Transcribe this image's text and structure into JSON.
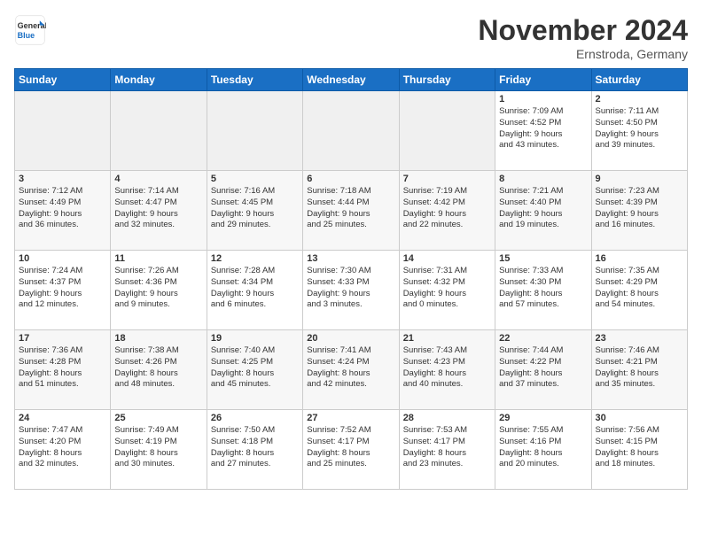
{
  "header": {
    "logo_general": "General",
    "logo_blue": "Blue",
    "month_title": "November 2024",
    "location": "Ernstroda, Germany"
  },
  "weekdays": [
    "Sunday",
    "Monday",
    "Tuesday",
    "Wednesday",
    "Thursday",
    "Friday",
    "Saturday"
  ],
  "weeks": [
    [
      {
        "day": "",
        "info": "",
        "empty": true
      },
      {
        "day": "",
        "info": "",
        "empty": true
      },
      {
        "day": "",
        "info": "",
        "empty": true
      },
      {
        "day": "",
        "info": "",
        "empty": true
      },
      {
        "day": "",
        "info": "",
        "empty": true
      },
      {
        "day": "1",
        "info": "Sunrise: 7:09 AM\nSunset: 4:52 PM\nDaylight: 9 hours\nand 43 minutes."
      },
      {
        "day": "2",
        "info": "Sunrise: 7:11 AM\nSunset: 4:50 PM\nDaylight: 9 hours\nand 39 minutes."
      }
    ],
    [
      {
        "day": "3",
        "info": "Sunrise: 7:12 AM\nSunset: 4:49 PM\nDaylight: 9 hours\nand 36 minutes."
      },
      {
        "day": "4",
        "info": "Sunrise: 7:14 AM\nSunset: 4:47 PM\nDaylight: 9 hours\nand 32 minutes."
      },
      {
        "day": "5",
        "info": "Sunrise: 7:16 AM\nSunset: 4:45 PM\nDaylight: 9 hours\nand 29 minutes."
      },
      {
        "day": "6",
        "info": "Sunrise: 7:18 AM\nSunset: 4:44 PM\nDaylight: 9 hours\nand 25 minutes."
      },
      {
        "day": "7",
        "info": "Sunrise: 7:19 AM\nSunset: 4:42 PM\nDaylight: 9 hours\nand 22 minutes."
      },
      {
        "day": "8",
        "info": "Sunrise: 7:21 AM\nSunset: 4:40 PM\nDaylight: 9 hours\nand 19 minutes."
      },
      {
        "day": "9",
        "info": "Sunrise: 7:23 AM\nSunset: 4:39 PM\nDaylight: 9 hours\nand 16 minutes."
      }
    ],
    [
      {
        "day": "10",
        "info": "Sunrise: 7:24 AM\nSunset: 4:37 PM\nDaylight: 9 hours\nand 12 minutes."
      },
      {
        "day": "11",
        "info": "Sunrise: 7:26 AM\nSunset: 4:36 PM\nDaylight: 9 hours\nand 9 minutes."
      },
      {
        "day": "12",
        "info": "Sunrise: 7:28 AM\nSunset: 4:34 PM\nDaylight: 9 hours\nand 6 minutes."
      },
      {
        "day": "13",
        "info": "Sunrise: 7:30 AM\nSunset: 4:33 PM\nDaylight: 9 hours\nand 3 minutes."
      },
      {
        "day": "14",
        "info": "Sunrise: 7:31 AM\nSunset: 4:32 PM\nDaylight: 9 hours\nand 0 minutes."
      },
      {
        "day": "15",
        "info": "Sunrise: 7:33 AM\nSunset: 4:30 PM\nDaylight: 8 hours\nand 57 minutes."
      },
      {
        "day": "16",
        "info": "Sunrise: 7:35 AM\nSunset: 4:29 PM\nDaylight: 8 hours\nand 54 minutes."
      }
    ],
    [
      {
        "day": "17",
        "info": "Sunrise: 7:36 AM\nSunset: 4:28 PM\nDaylight: 8 hours\nand 51 minutes."
      },
      {
        "day": "18",
        "info": "Sunrise: 7:38 AM\nSunset: 4:26 PM\nDaylight: 8 hours\nand 48 minutes."
      },
      {
        "day": "19",
        "info": "Sunrise: 7:40 AM\nSunset: 4:25 PM\nDaylight: 8 hours\nand 45 minutes."
      },
      {
        "day": "20",
        "info": "Sunrise: 7:41 AM\nSunset: 4:24 PM\nDaylight: 8 hours\nand 42 minutes."
      },
      {
        "day": "21",
        "info": "Sunrise: 7:43 AM\nSunset: 4:23 PM\nDaylight: 8 hours\nand 40 minutes."
      },
      {
        "day": "22",
        "info": "Sunrise: 7:44 AM\nSunset: 4:22 PM\nDaylight: 8 hours\nand 37 minutes."
      },
      {
        "day": "23",
        "info": "Sunrise: 7:46 AM\nSunset: 4:21 PM\nDaylight: 8 hours\nand 35 minutes."
      }
    ],
    [
      {
        "day": "24",
        "info": "Sunrise: 7:47 AM\nSunset: 4:20 PM\nDaylight: 8 hours\nand 32 minutes."
      },
      {
        "day": "25",
        "info": "Sunrise: 7:49 AM\nSunset: 4:19 PM\nDaylight: 8 hours\nand 30 minutes."
      },
      {
        "day": "26",
        "info": "Sunrise: 7:50 AM\nSunset: 4:18 PM\nDaylight: 8 hours\nand 27 minutes."
      },
      {
        "day": "27",
        "info": "Sunrise: 7:52 AM\nSunset: 4:17 PM\nDaylight: 8 hours\nand 25 minutes."
      },
      {
        "day": "28",
        "info": "Sunrise: 7:53 AM\nSunset: 4:17 PM\nDaylight: 8 hours\nand 23 minutes."
      },
      {
        "day": "29",
        "info": "Sunrise: 7:55 AM\nSunset: 4:16 PM\nDaylight: 8 hours\nand 20 minutes."
      },
      {
        "day": "30",
        "info": "Sunrise: 7:56 AM\nSunset: 4:15 PM\nDaylight: 8 hours\nand 18 minutes."
      }
    ]
  ]
}
